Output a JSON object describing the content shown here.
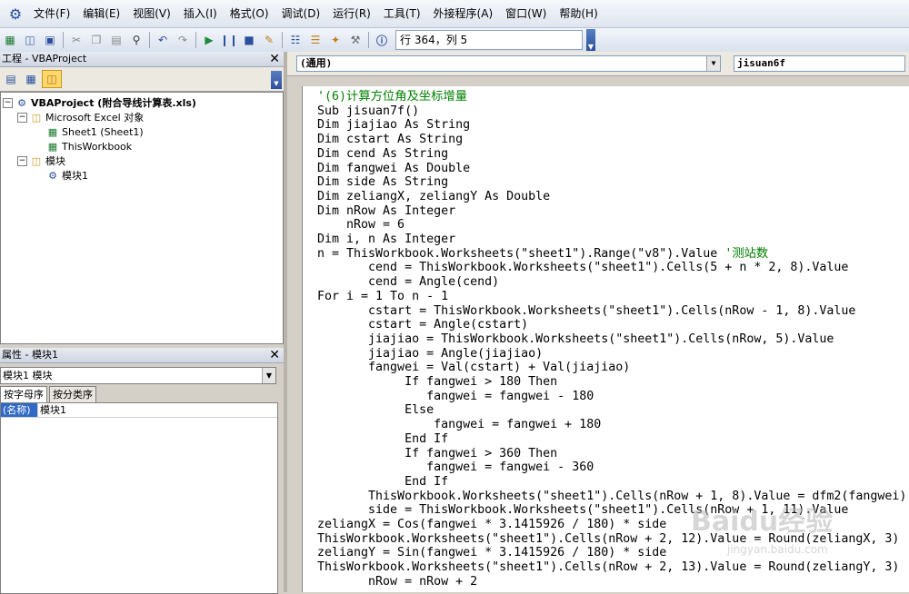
{
  "menu": {
    "items": [
      "文件(F)",
      "编辑(E)",
      "视图(V)",
      "插入(I)",
      "格式(O)",
      "调试(D)",
      "运行(R)",
      "工具(T)",
      "外接程序(A)",
      "窗口(W)",
      "帮助(H)"
    ]
  },
  "toolbar": {
    "status": "行 364，列 5"
  },
  "project_panel": {
    "title": "工程 - VBAProject",
    "tree": {
      "root": "VBAProject (附合导线计算表.xls)",
      "excel_objects": "Microsoft Excel 对象",
      "sheet1": "Sheet1 (Sheet1)",
      "thisworkbook": "ThisWorkbook",
      "modules": "模块",
      "module1": "模块1"
    }
  },
  "properties_panel": {
    "title": "属性 - 模块1",
    "selected": "模块1 模块",
    "tab_alpha": "按字母序",
    "tab_category": "按分类序",
    "name_key": "(名称)",
    "name_value": "模块1"
  },
  "code_window": {
    "object_combo": "(通用)",
    "proc_combo": "jisuan6f",
    "lines": [
      {
        "text": "'(6)计算方位角及坐标增量",
        "comment": true
      },
      {
        "text": "Sub jisuan7f()"
      },
      {
        "text": "Dim jiajiao As String"
      },
      {
        "text": "Dim cstart As String"
      },
      {
        "text": "Dim cend As String"
      },
      {
        "text": "Dim fangwei As Double"
      },
      {
        "text": "Dim side As String"
      },
      {
        "text": "Dim zeliangX, zeliangY As Double"
      },
      {
        "text": "Dim nRow As Integer"
      },
      {
        "text": "    nRow = 6"
      },
      {
        "text": "Dim i, n As Integer"
      },
      {
        "text": "n = ThisWorkbook.Worksheets(\"sheet1\").Range(\"v8\").Value ",
        "tail": "'测站数"
      },
      {
        "text": "       cend = ThisWorkbook.Worksheets(\"sheet1\").Cells(5 + n * 2, 8).Value"
      },
      {
        "text": "       cend = Angle(cend)"
      },
      {
        "text": "For i = 1 To n - 1"
      },
      {
        "text": "       cstart = ThisWorkbook.Worksheets(\"sheet1\").Cells(nRow - 1, 8).Value"
      },
      {
        "text": "       cstart = Angle(cstart)"
      },
      {
        "text": "       jiajiao = ThisWorkbook.Worksheets(\"sheet1\").Cells(nRow, 5).Value"
      },
      {
        "text": "       jiajiao = Angle(jiajiao)"
      },
      {
        "text": "       fangwei = Val(cstart) + Val(jiajiao)"
      },
      {
        "text": "            If fangwei > 180 Then"
      },
      {
        "text": "               fangwei = fangwei - 180"
      },
      {
        "text": "            Else"
      },
      {
        "text": "                fangwei = fangwei + 180"
      },
      {
        "text": "            End If"
      },
      {
        "text": "            If fangwei > 360 Then"
      },
      {
        "text": "               fangwei = fangwei - 360"
      },
      {
        "text": "            End If"
      },
      {
        "text": "       ThisWorkbook.Worksheets(\"sheet1\").Cells(nRow + 1, 8).Value = dfm2(fangwei)"
      },
      {
        "text": "       side = ThisWorkbook.Worksheets(\"sheet1\").Cells(nRow + 1, 11).Value"
      },
      {
        "text": "zeliangX = Cos(fangwei * 3.1415926 / 180) * side"
      },
      {
        "text": "ThisWorkbook.Worksheets(\"sheet1\").Cells(nRow + 2, 12).Value = Round(zeliangX, 3)"
      },
      {
        "text": "zeliangY = Sin(fangwei * 3.1415926 / 180) * side"
      },
      {
        "text": "ThisWorkbook.Worksheets(\"sheet1\").Cells(nRow + 2, 13).Value = Round(zeliangY, 3)"
      },
      {
        "text": "       nRow = nRow + 2"
      }
    ]
  },
  "watermark": {
    "main": "Baidu经验",
    "sub": "jingyan.baidu.com"
  },
  "colors": {
    "comment": "#008000",
    "selection": "#316ac5"
  }
}
